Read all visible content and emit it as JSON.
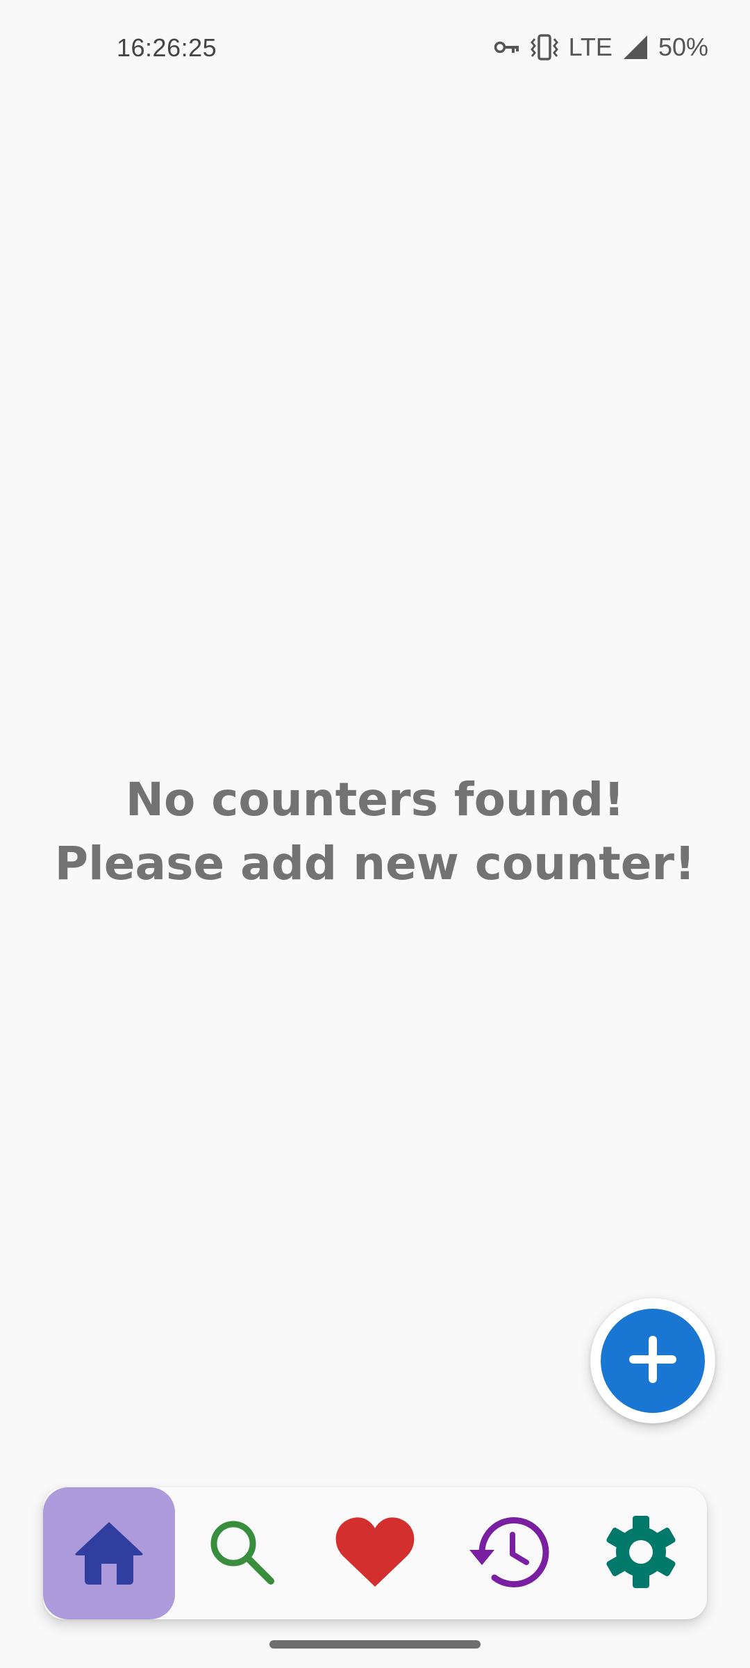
{
  "status_bar": {
    "time": "16:26:25",
    "network": "LTE",
    "battery": "50%",
    "icons": [
      "vpn-key-icon",
      "vibrate-icon",
      "signal-icon"
    ]
  },
  "empty_state": {
    "line1": "No counters found!",
    "line2": "Please add new counter!"
  },
  "fab": {
    "icon": "plus-icon",
    "color": "#1976d2"
  },
  "bottom_nav": {
    "items": [
      {
        "id": "home",
        "icon": "home-icon",
        "color": "#303f9f",
        "active": true,
        "active_bg": "#ad9ada"
      },
      {
        "id": "search",
        "icon": "search-icon",
        "color": "#388e3c",
        "active": false
      },
      {
        "id": "favorites",
        "icon": "heart-icon",
        "color": "#d32f2f",
        "active": false
      },
      {
        "id": "history",
        "icon": "history-icon",
        "color": "#7b1fa2",
        "active": false
      },
      {
        "id": "settings",
        "icon": "gear-icon",
        "color": "#00796b",
        "active": false
      }
    ]
  }
}
